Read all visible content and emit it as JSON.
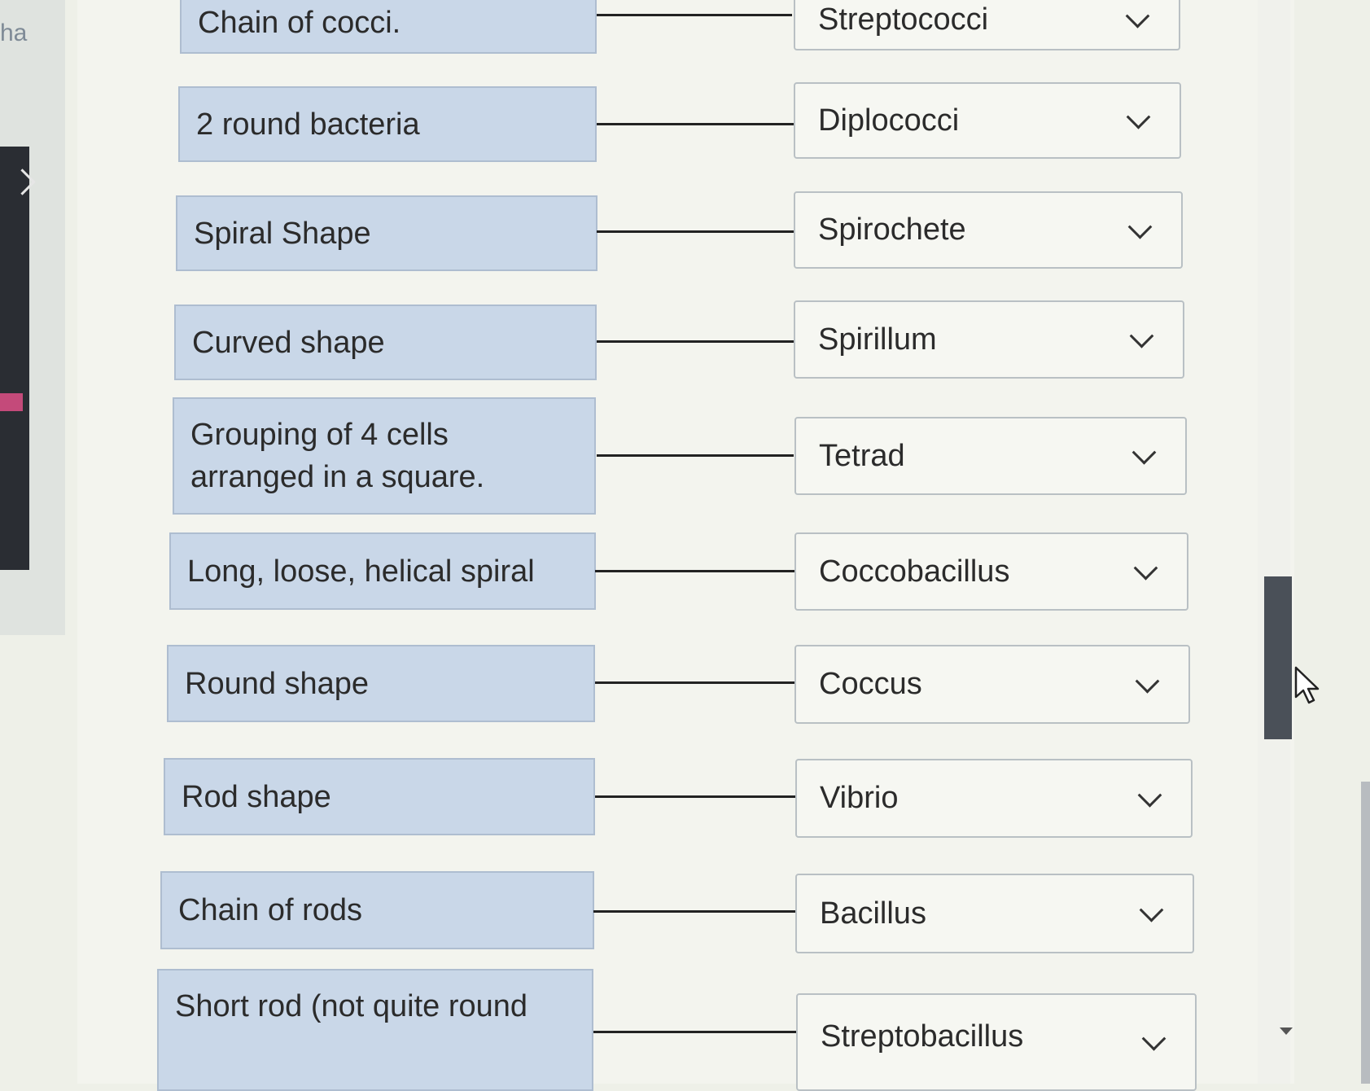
{
  "side_panel": {
    "partial_label": "ha"
  },
  "matching": {
    "rows": [
      {
        "term": "Chain of cocci.",
        "answer": "Streptococci"
      },
      {
        "term": "2 round bacteria",
        "answer": "Diplococci"
      },
      {
        "term": "Spiral Shape",
        "answer": "Spirochete"
      },
      {
        "term": "Curved shape",
        "answer": "Spirillum"
      },
      {
        "term": "Grouping of 4 cells arranged in a square.",
        "answer": "Tetrad"
      },
      {
        "term": "Long, loose, helical spiral",
        "answer": "Coccobacillus"
      },
      {
        "term": "Round shape",
        "answer": "Coccus"
      },
      {
        "term": "Rod shape",
        "answer": "Vibrio"
      },
      {
        "term": "Chain of rods",
        "answer": "Bacillus"
      },
      {
        "term": "Short rod (not quite round",
        "answer": "Streptobacillus"
      }
    ]
  },
  "colors": {
    "term_bg": "#c9d7e8",
    "select_bg": "#f6f7f2",
    "scroll_thumb": "#4a5058"
  },
  "icons": {
    "dropdown": "chevron-down-icon",
    "side_expand": "chevron-right-icon",
    "cursor": "mouse-pointer-icon"
  }
}
